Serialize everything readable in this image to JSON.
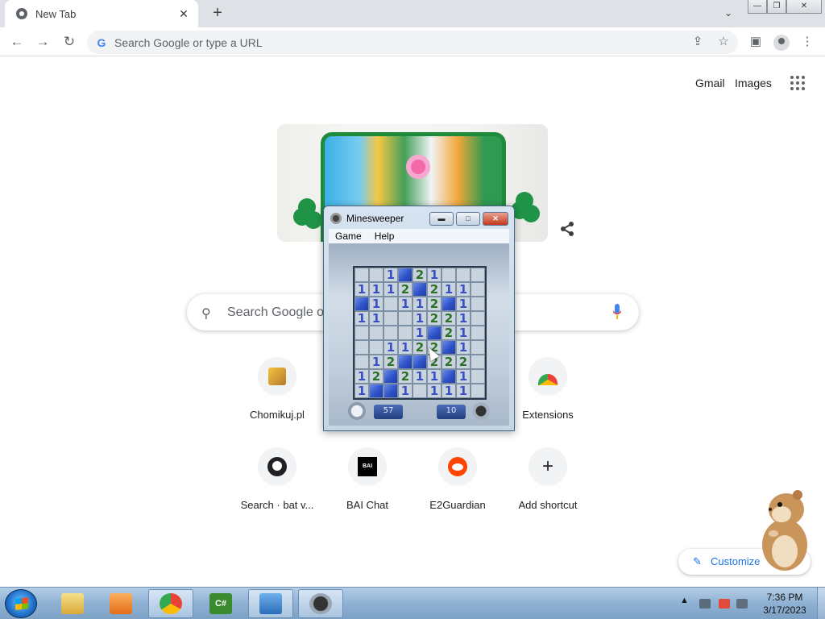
{
  "browser": {
    "tab_title": "New Tab",
    "omnibox_placeholder": "Search Google or type a URL"
  },
  "ntp": {
    "gmail": "Gmail",
    "images": "Images",
    "search_placeholder": "Search Google or type a URL",
    "customize": "Customize",
    "shortcuts": [
      {
        "label": "Chomikuj.pl",
        "icon": "chomikuj-icon"
      },
      {
        "label": "Extensions",
        "icon": "chrome-web-store-icon"
      },
      {
        "label": "Search · bat v...",
        "icon": "github-icon"
      },
      {
        "label": "BAI Chat",
        "icon": "bai-icon"
      },
      {
        "label": "E2Guardian",
        "icon": "reddit-icon"
      },
      {
        "label": "Add shortcut",
        "icon": "plus-icon"
      }
    ]
  },
  "minesweeper": {
    "title": "Minesweeper",
    "menu": [
      "Game",
      "Help"
    ],
    "timer": "57",
    "mines_left": "10",
    "board": [
      [
        "r",
        "r",
        "1",
        "c",
        "2",
        "1",
        "r",
        "r",
        "r"
      ],
      [
        "1",
        "1",
        "1",
        "2",
        "c",
        "2",
        "1",
        "1",
        "r"
      ],
      [
        "c",
        "1",
        "r",
        "1",
        "1",
        "2",
        "c",
        "1",
        "r"
      ],
      [
        "1",
        "1",
        "r",
        "r",
        "1",
        "2",
        "2",
        "1",
        "r"
      ],
      [
        "r",
        "r",
        "r",
        "r",
        "1",
        "c",
        "2",
        "1",
        "r"
      ],
      [
        "r",
        "r",
        "1",
        "1",
        "2",
        "2",
        "c",
        "1",
        "r"
      ],
      [
        "r",
        "1",
        "2",
        "c",
        "c",
        "2",
        "2",
        "2",
        "r"
      ],
      [
        "1",
        "2",
        "c",
        "2",
        "1",
        "1",
        "c",
        "1",
        "r"
      ],
      [
        "1",
        "c",
        "c",
        "1",
        "r",
        "1",
        "1",
        "1",
        "r"
      ]
    ]
  },
  "taskbar": {
    "time": "7:36 PM",
    "date": "3/17/2023",
    "tray_arrow": "▲"
  }
}
